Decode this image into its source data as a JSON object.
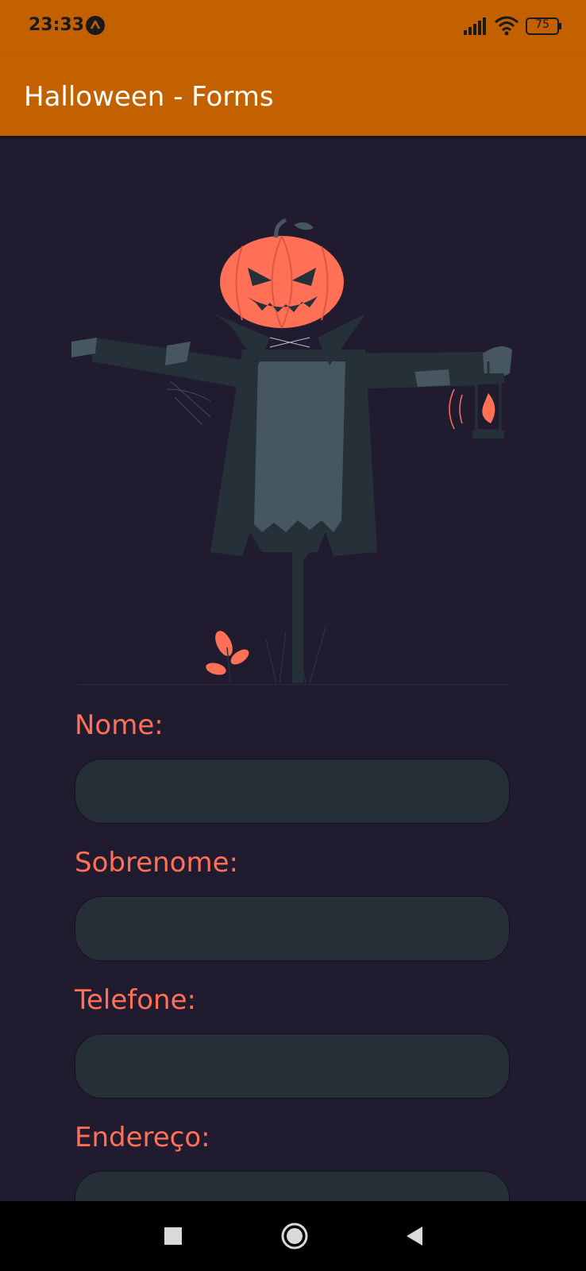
{
  "status_bar": {
    "time": "23:33",
    "battery": "75",
    "icons": [
      "app-notification-icon",
      "signal-icon",
      "wifi-icon",
      "battery-icon"
    ]
  },
  "app_bar": {
    "title": "Halloween - Forms",
    "color": "#c36100"
  },
  "illustration": {
    "subject": "scarecrow-pumpkin-illustration"
  },
  "form": {
    "fields": [
      {
        "label": "Nome:",
        "value": ""
      },
      {
        "label": "Sobrenome:",
        "value": ""
      },
      {
        "label": "Telefone:",
        "value": ""
      },
      {
        "label": "Endereço:",
        "value": ""
      }
    ],
    "label_color": "#ff7057",
    "input_color": "#262f38"
  },
  "nav_bar": {
    "buttons": [
      "recents-square-icon",
      "home-circle-icon",
      "back-triangle-icon"
    ]
  },
  "colors": {
    "background": "#201b2e",
    "accent": "#c36100"
  }
}
